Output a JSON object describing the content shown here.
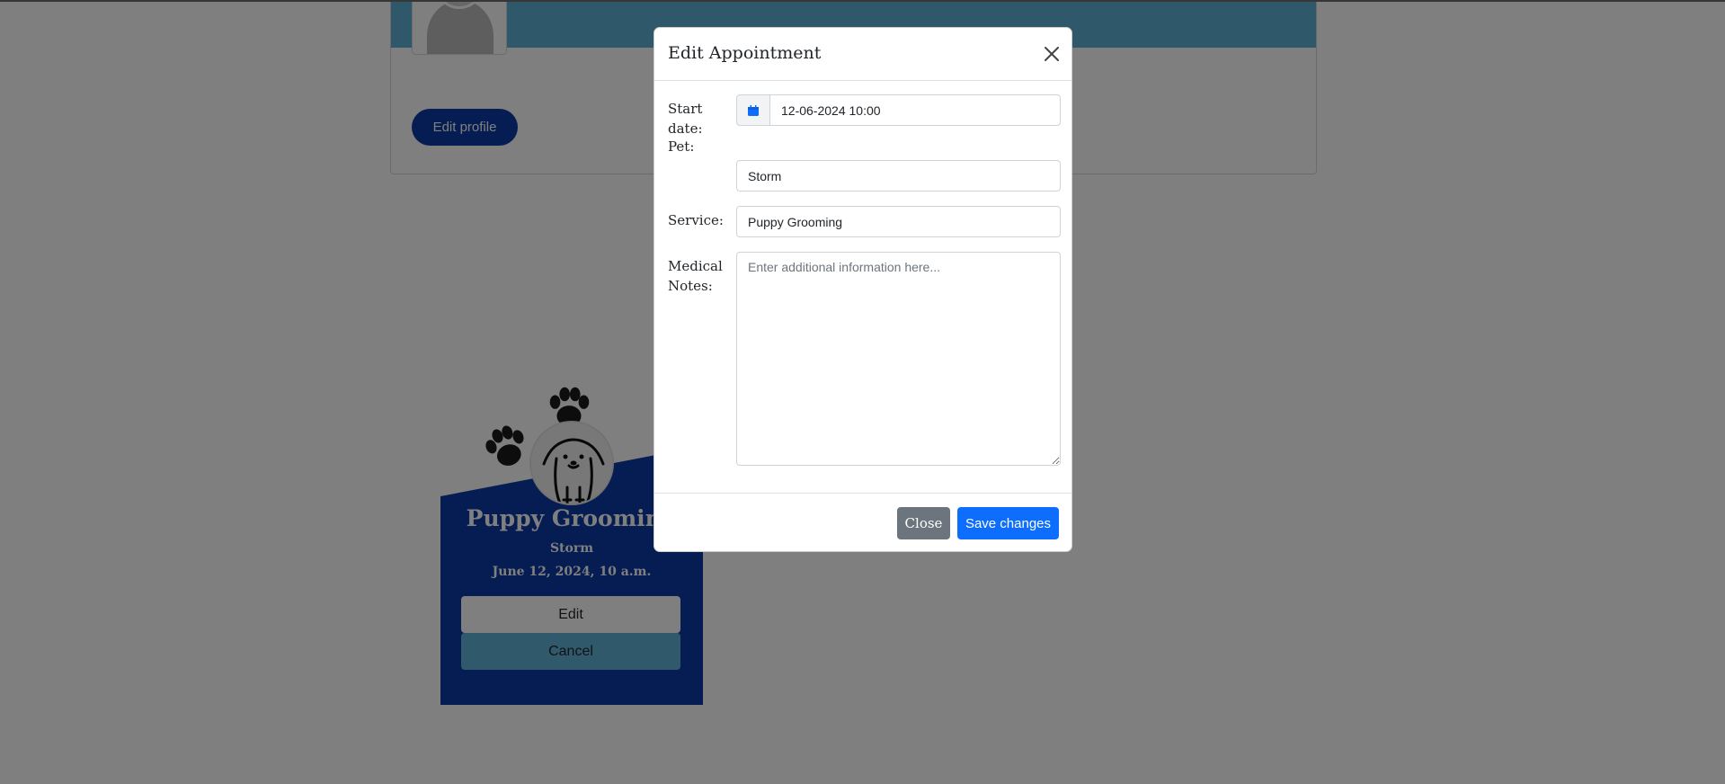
{
  "profile": {
    "edit_profile_label": "Edit profile"
  },
  "appointment_card": {
    "service": "Puppy Grooming",
    "pet": "Storm",
    "date": "June 12, 2024, 10 a.m.",
    "edit_label": "Edit",
    "cancel_label": "Cancel"
  },
  "modal": {
    "title": "Edit Appointment",
    "fields": {
      "start_date_label": "Start date:",
      "start_date_value": "12-06-2024 10:00",
      "pet_label": "Pet:",
      "pet_value": "Storm",
      "service_label": "Service:",
      "service_value": "Puppy Grooming",
      "notes_label": "Medical Notes:",
      "notes_placeholder": "Enter additional information here..."
    },
    "close_label": "Close",
    "save_label": "Save changes"
  },
  "colors": {
    "navy": "#0a3aa6",
    "sky": "#5fb0d6",
    "primary": "#0d6efd",
    "secondary": "#6c757d"
  },
  "icons": {
    "date_addon": "calendar-icon",
    "modal_close": "close-icon"
  }
}
